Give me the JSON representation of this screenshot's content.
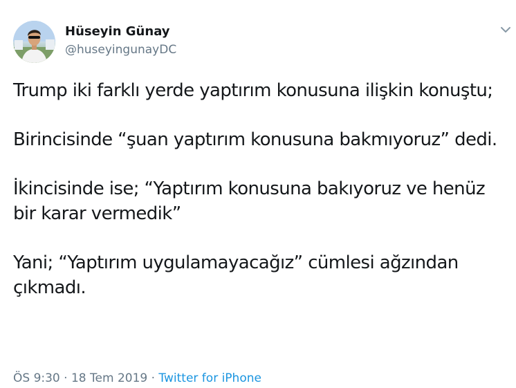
{
  "author": {
    "display_name": "Hüseyin Günay",
    "handle": "@huseyingunayDC"
  },
  "icons": {
    "avatar": "profile-photo",
    "menu": "chevron-down-icon"
  },
  "tweet": {
    "paragraphs": [
      "Trump iki farklı yerde yaptırım konusuna ilişkin konuştu;",
      "Birincisinde “şuan yaptırım konusuna bakmıyoruz” dedi.",
      "İkincisinde ise; “Yaptırım konusuna bakıyoruz ve henüz bir karar vermedik”",
      "Yani; “Yaptırım uygulamayacağız” cümlesi ağzından çıkmadı."
    ]
  },
  "meta": {
    "time": "ÖS 9:30",
    "separator": "·",
    "date": "18 Tem 2019",
    "source": "Twitter for iPhone"
  },
  "colors": {
    "text": "#14171a",
    "secondary": "#657786",
    "link": "#1b95e0"
  }
}
